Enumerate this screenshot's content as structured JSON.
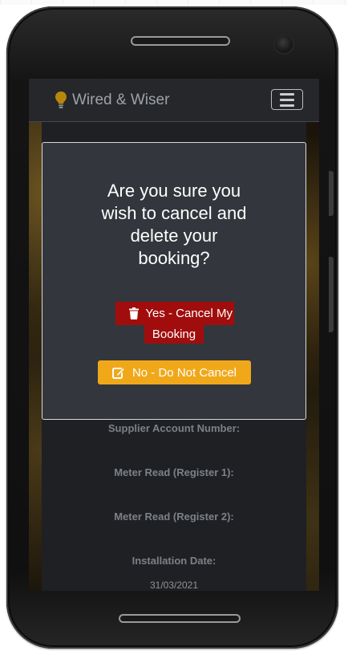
{
  "app": {
    "brand": "Wired & Wiser"
  },
  "modal": {
    "title_lines": [
      "Are you sure you",
      "wish to cancel and",
      "delete your",
      "booking?"
    ],
    "yes_label_line1": "Yes - Cancel My",
    "yes_label_line2": "Booking",
    "no_label": "No - Do Not Cancel"
  },
  "details": {
    "supplier_account_label": "Supplier Account Number:",
    "meter_read_1_label": "Meter Read (Register 1):",
    "meter_read_2_label": "Meter Read (Register 2):",
    "installation_date_label": "Installation Date:",
    "installation_date_value": "31/03/2021"
  },
  "colors": {
    "danger": "#a10d0d",
    "warning": "#f0a81a",
    "navbar": "#25272b",
    "modal_bg": "#33363c"
  },
  "icons": {
    "brand": "lightbulb-icon",
    "menu": "hamburger-menu-icon",
    "yes": "trash-icon",
    "no": "edit-icon"
  }
}
